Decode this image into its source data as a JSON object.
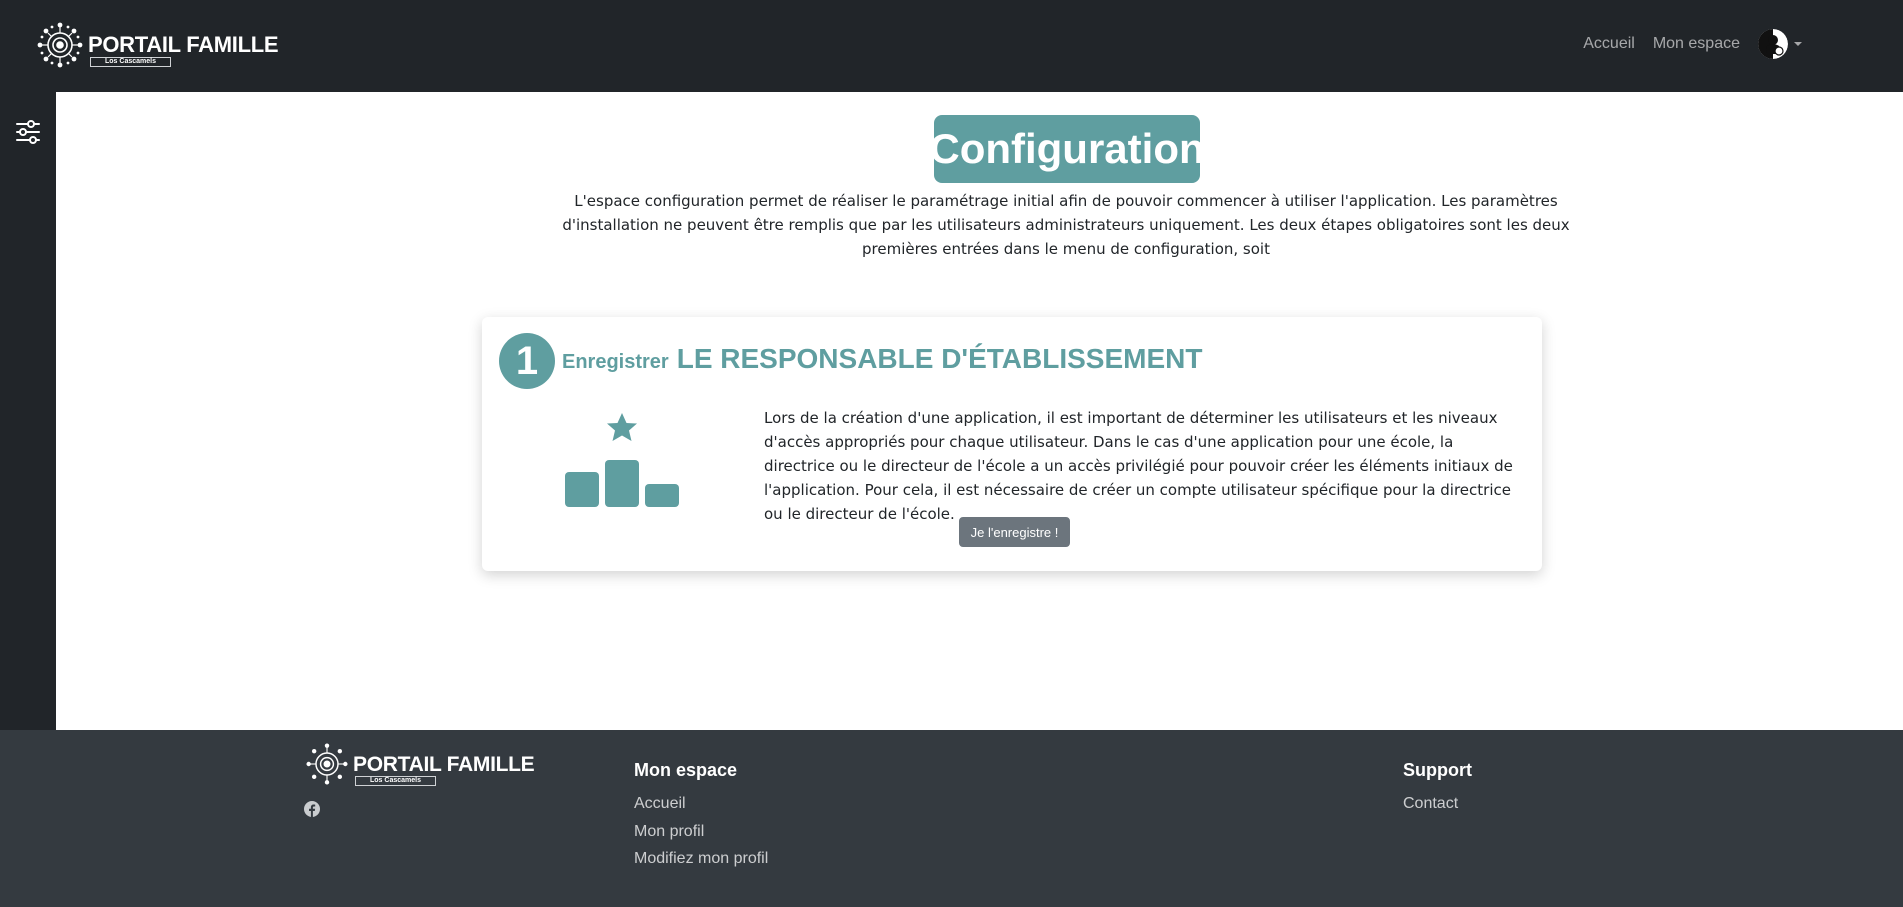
{
  "brand": {
    "title": "PORTAIL FAMILLE",
    "subtitle": "Los Cascamels",
    "logo_icon": "mandala-logo-icon"
  },
  "nav": {
    "links": [
      "Accueil",
      "Mon espace"
    ],
    "user_avatar_icon": "user-avatar-icon",
    "dropdown_icon": "caret-down-icon"
  },
  "sidebar": {
    "toggle_icon": "sliders-icon"
  },
  "main": {
    "title": "Configuration",
    "intro": "L'espace configuration permet de réaliser le paramétrage initial afin de pouvoir commencer à utiliser l'application. Les paramètres d'installation ne peuvent être remplis que par les utilisateurs administrateurs uniquement. Les deux étapes obligatoires sont les deux premières entrées dans le menu de configuration, soit",
    "step": {
      "number": "1",
      "verb": "Enregistrer",
      "title": "LE RESPONSABLE D'ÉTABLISSEMENT",
      "icon": "podium-star-icon",
      "text": "Lors de la création d'une application, il est important de déterminer les utilisateurs et les niveaux d'accès appropriés pour chaque utilisateur. Dans le cas d'une application pour une école, la directrice ou le directeur de l'école a un accès privilégié pour pouvoir créer les éléments initiaux de l'application. Pour cela, il est nécessaire de créer un compte utilisateur spécifique pour la directrice ou le directeur de l'école.",
      "button": "Je l'enregistre !"
    }
  },
  "footer": {
    "brand_title": "PORTAIL FAMILLE",
    "brand_subtitle": "Los Cascamels",
    "social_icon": "facebook-icon",
    "columns": [
      {
        "heading": "Mon espace",
        "links": [
          "Accueil",
          "Mon profil",
          "Modifiez mon profil"
        ]
      },
      {
        "heading": "Support",
        "links": [
          "Contact"
        ]
      }
    ]
  },
  "colors": {
    "navbar": "#212529",
    "footer": "#343a40",
    "accent": "#5f9ea0",
    "button": "#6c757d"
  }
}
